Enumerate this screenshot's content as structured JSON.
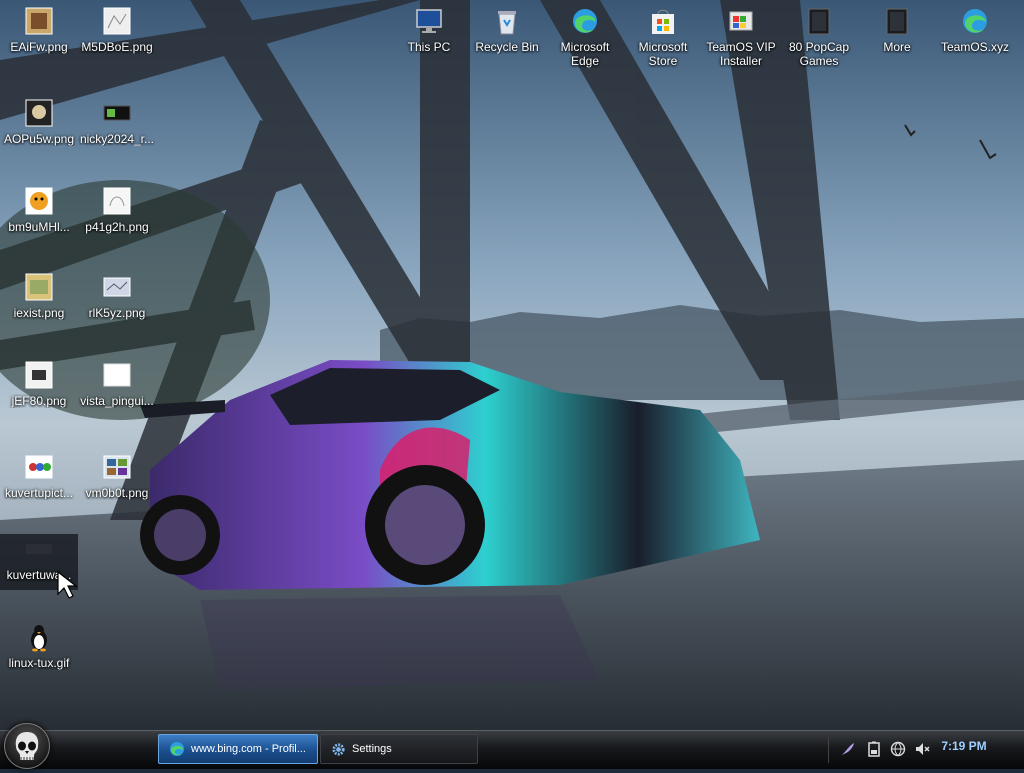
{
  "desktop": {
    "left_icons": [
      {
        "label": "EAiFw.png",
        "icon": "image-file-icon"
      },
      {
        "label": "M5DBoE.png",
        "icon": "image-file-icon"
      },
      {
        "label": "AOPu5w.png",
        "icon": "image-file-icon"
      },
      {
        "label": "nicky2024_r...",
        "icon": "image-file-icon"
      },
      {
        "label": "bm9uMHl...",
        "icon": "image-file-icon"
      },
      {
        "label": "p41g2h.png",
        "icon": "image-file-icon"
      },
      {
        "label": "iexist.png",
        "icon": "image-file-icon"
      },
      {
        "label": "rlK5yz.png",
        "icon": "image-file-icon"
      },
      {
        "label": "jEF80.png",
        "icon": "image-file-icon"
      },
      {
        "label": "vista_pingui...",
        "icon": "image-file-icon"
      },
      {
        "label": "kuvertupict...",
        "icon": "image-file-icon"
      },
      {
        "label": "vm0b0t.png",
        "icon": "image-file-icon"
      },
      {
        "label": "kuvertuwa...",
        "icon": "image-file-icon"
      },
      {
        "label": "linux-tux.gif",
        "icon": "tux-penguin-icon"
      }
    ],
    "top_icons": [
      {
        "label": "This PC",
        "icon": "computer-monitor-icon"
      },
      {
        "label": "Recycle Bin",
        "icon": "recycle-bin-icon"
      },
      {
        "label": "Microsoft Edge",
        "icon": "edge-browser-icon"
      },
      {
        "label": "Microsoft Store",
        "icon": "store-bag-icon"
      },
      {
        "label": "TeamOS VIP Installer",
        "icon": "installer-icon"
      },
      {
        "label": "80 PopCap Games",
        "icon": "games-folder-icon"
      },
      {
        "label": "More",
        "icon": "folder-icon"
      },
      {
        "label": "TeamOS.xyz",
        "icon": "edge-browser-icon"
      }
    ]
  },
  "taskbar": {
    "windows": [
      {
        "label": "www.bing.com - Profil...",
        "icon": "edge-browser-icon",
        "state": "active"
      },
      {
        "label": "Settings",
        "icon": "gear-icon",
        "state": "inactive"
      }
    ],
    "tray": [
      "feather-icon",
      "battery-icon",
      "network-icon",
      "volume-muted-icon"
    ],
    "clock": "7:19 PM"
  },
  "colors": {
    "taskbar_active": "#2a66ad",
    "clock_text": "#9fd0ff"
  }
}
